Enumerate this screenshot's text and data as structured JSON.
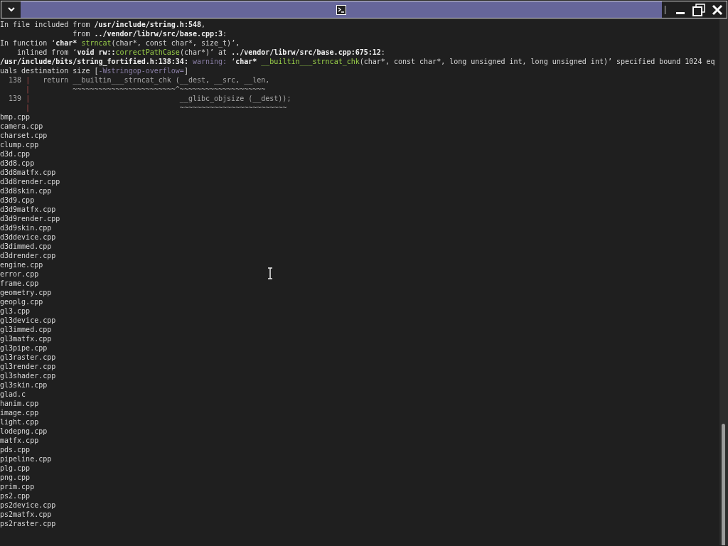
{
  "lines": [
    [
      {
        "kind": "plain",
        "text": "In file included from "
      },
      {
        "kind": "bold",
        "text": "/usr/include/string.h:548"
      },
      {
        "kind": "plain",
        "text": ","
      }
    ],
    [
      {
        "kind": "plain",
        "text": "                 from "
      },
      {
        "kind": "bold",
        "text": "../vendor/librw/src/base.cpp:3"
      },
      {
        "kind": "plain",
        "text": ":"
      }
    ],
    [
      {
        "kind": "plain",
        "text": "In function ‘"
      },
      {
        "kind": "bold",
        "text": "char* "
      },
      {
        "kind": "green",
        "text": "strncat"
      },
      {
        "kind": "plain",
        "text": "(char*, const char*, size_t)’,"
      }
    ],
    [
      {
        "kind": "plain",
        "text": "    inlined from ‘"
      },
      {
        "kind": "bold",
        "text": "void rw::"
      },
      {
        "kind": "green",
        "text": "correctPathCase"
      },
      {
        "kind": "plain",
        "text": "(char*)’ at "
      },
      {
        "kind": "bold",
        "text": "../vendor/librw/src/base.cpp:675:12"
      },
      {
        "kind": "plain",
        "text": ":"
      }
    ],
    [
      {
        "kind": "bold",
        "text": "/usr/include/bits/string_fortified.h:138:34: "
      },
      {
        "kind": "warning",
        "text": "warning: "
      },
      {
        "kind": "plain",
        "text": "‘"
      },
      {
        "kind": "bold",
        "text": "char* "
      },
      {
        "kind": "green",
        "text": "__builtin___strncat_chk"
      },
      {
        "kind": "plain",
        "text": "(char*, const char*, long unsigned int, long unsigned int)’ specified bound 1024 eq"
      }
    ],
    [
      {
        "kind": "plain",
        "text": "uals destination size ["
      },
      {
        "kind": "warning",
        "text": "-Wstringop-overflow="
      },
      {
        "kind": "plain",
        "text": "]"
      }
    ],
    [
      {
        "kind": "dim",
        "text": "  138 "
      },
      {
        "kind": "gutter",
        "text": "|"
      },
      {
        "kind": "dim",
        "text": "   return __builtin___strncat_chk (__dest, __src, __len,"
      }
    ],
    [
      {
        "kind": "gutter",
        "text": "      |"
      },
      {
        "kind": "dim",
        "text": "          ~~~~~~~~~~~~~~~~~~~~~~~~^~~~~~~~~~~~~~~~~~~~~"
      }
    ],
    [
      {
        "kind": "dim",
        "text": "  139 "
      },
      {
        "kind": "gutter",
        "text": "|"
      },
      {
        "kind": "dim",
        "text": "                                   __glibc_objsize (__dest));"
      }
    ],
    [
      {
        "kind": "gutter",
        "text": "      |"
      },
      {
        "kind": "dim",
        "text": "                                   ~~~~~~~~~~~~~~~~~~~~~~~~~"
      }
    ],
    [
      {
        "kind": "plain",
        "text": "bmp.cpp"
      }
    ],
    [
      {
        "kind": "plain",
        "text": "camera.cpp"
      }
    ],
    [
      {
        "kind": "plain",
        "text": "charset.cpp"
      }
    ],
    [
      {
        "kind": "plain",
        "text": "clump.cpp"
      }
    ],
    [
      {
        "kind": "plain",
        "text": "d3d.cpp"
      }
    ],
    [
      {
        "kind": "plain",
        "text": "d3d8.cpp"
      }
    ],
    [
      {
        "kind": "plain",
        "text": "d3d8matfx.cpp"
      }
    ],
    [
      {
        "kind": "plain",
        "text": "d3d8render.cpp"
      }
    ],
    [
      {
        "kind": "plain",
        "text": "d3d8skin.cpp"
      }
    ],
    [
      {
        "kind": "plain",
        "text": "d3d9.cpp"
      }
    ],
    [
      {
        "kind": "plain",
        "text": "d3d9matfx.cpp"
      }
    ],
    [
      {
        "kind": "plain",
        "text": "d3d9render.cpp"
      }
    ],
    [
      {
        "kind": "plain",
        "text": "d3d9skin.cpp"
      }
    ],
    [
      {
        "kind": "plain",
        "text": "d3ddevice.cpp"
      }
    ],
    [
      {
        "kind": "plain",
        "text": "d3dimmed.cpp"
      }
    ],
    [
      {
        "kind": "plain",
        "text": "d3drender.cpp"
      }
    ],
    [
      {
        "kind": "plain",
        "text": "engine.cpp"
      }
    ],
    [
      {
        "kind": "plain",
        "text": "error.cpp"
      }
    ],
    [
      {
        "kind": "plain",
        "text": "frame.cpp"
      }
    ],
    [
      {
        "kind": "plain",
        "text": "geometry.cpp"
      }
    ],
    [
      {
        "kind": "plain",
        "text": "geoplg.cpp"
      }
    ],
    [
      {
        "kind": "plain",
        "text": "gl3.cpp"
      }
    ],
    [
      {
        "kind": "plain",
        "text": "gl3device.cpp"
      }
    ],
    [
      {
        "kind": "plain",
        "text": "gl3immed.cpp"
      }
    ],
    [
      {
        "kind": "plain",
        "text": "gl3matfx.cpp"
      }
    ],
    [
      {
        "kind": "plain",
        "text": "gl3pipe.cpp"
      }
    ],
    [
      {
        "kind": "plain",
        "text": "gl3raster.cpp"
      }
    ],
    [
      {
        "kind": "plain",
        "text": "gl3render.cpp"
      }
    ],
    [
      {
        "kind": "plain",
        "text": "gl3shader.cpp"
      }
    ],
    [
      {
        "kind": "plain",
        "text": "gl3skin.cpp"
      }
    ],
    [
      {
        "kind": "plain",
        "text": "glad.c"
      }
    ],
    [
      {
        "kind": "plain",
        "text": "hanim.cpp"
      }
    ],
    [
      {
        "kind": "plain",
        "text": "image.cpp"
      }
    ],
    [
      {
        "kind": "plain",
        "text": "light.cpp"
      }
    ],
    [
      {
        "kind": "plain",
        "text": "lodepng.cpp"
      }
    ],
    [
      {
        "kind": "plain",
        "text": "matfx.cpp"
      }
    ],
    [
      {
        "kind": "plain",
        "text": "pds.cpp"
      }
    ],
    [
      {
        "kind": "plain",
        "text": "pipeline.cpp"
      }
    ],
    [
      {
        "kind": "plain",
        "text": "plg.cpp"
      }
    ],
    [
      {
        "kind": "plain",
        "text": "png.cpp"
      }
    ],
    [
      {
        "kind": "plain",
        "text": "prim.cpp"
      }
    ],
    [
      {
        "kind": "plain",
        "text": "ps2.cpp"
      }
    ],
    [
      {
        "kind": "plain",
        "text": "ps2device.cpp"
      }
    ],
    [
      {
        "kind": "plain",
        "text": "ps2matfx.cpp"
      }
    ],
    [
      {
        "kind": "plain",
        "text": "ps2raster.cpp"
      }
    ]
  ]
}
